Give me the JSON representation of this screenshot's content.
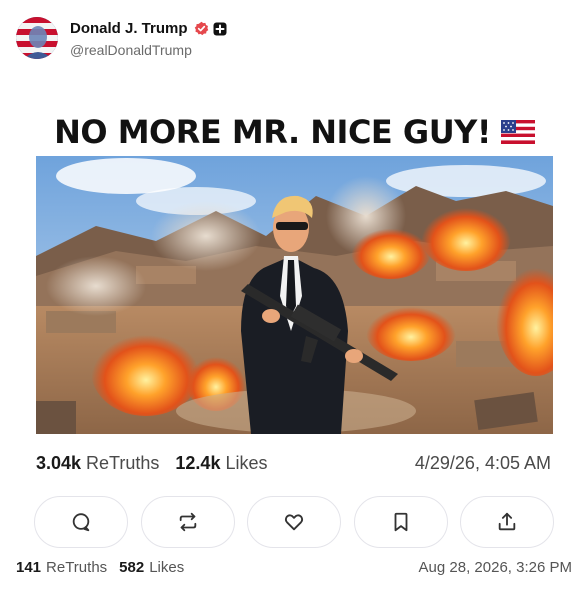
{
  "author": {
    "display_name": "Donald J. Trump",
    "handle": "@realDonaldTrump"
  },
  "post": {
    "headline": "NO MORE MR. NICE GUY!",
    "flag_emoji": "us-flag",
    "image_description_icon": "man-with-rifle-explosions",
    "retruths_count": "3.04k",
    "retruths_label": "ReTruths",
    "likes_count": "12.4k",
    "likes_label": "Likes",
    "timestamp": "4/29/26, 4:05 AM"
  },
  "actions": [
    {
      "icon": "reply-icon"
    },
    {
      "icon": "retruth-icon"
    },
    {
      "icon": "like-icon"
    },
    {
      "icon": "bookmark-icon"
    },
    {
      "icon": "share-icon"
    }
  ],
  "footer": {
    "retruths_count": "141",
    "retruths_label": "ReTruths",
    "likes_count": "582",
    "likes_label": "Likes",
    "timestamp": "Aug 28, 2026, 3:26 PM"
  },
  "colors": {
    "verified_badge": "#e5484d",
    "text_primary": "#111111",
    "text_secondary": "#6b6b6b",
    "button_border": "#e4e4ea"
  }
}
